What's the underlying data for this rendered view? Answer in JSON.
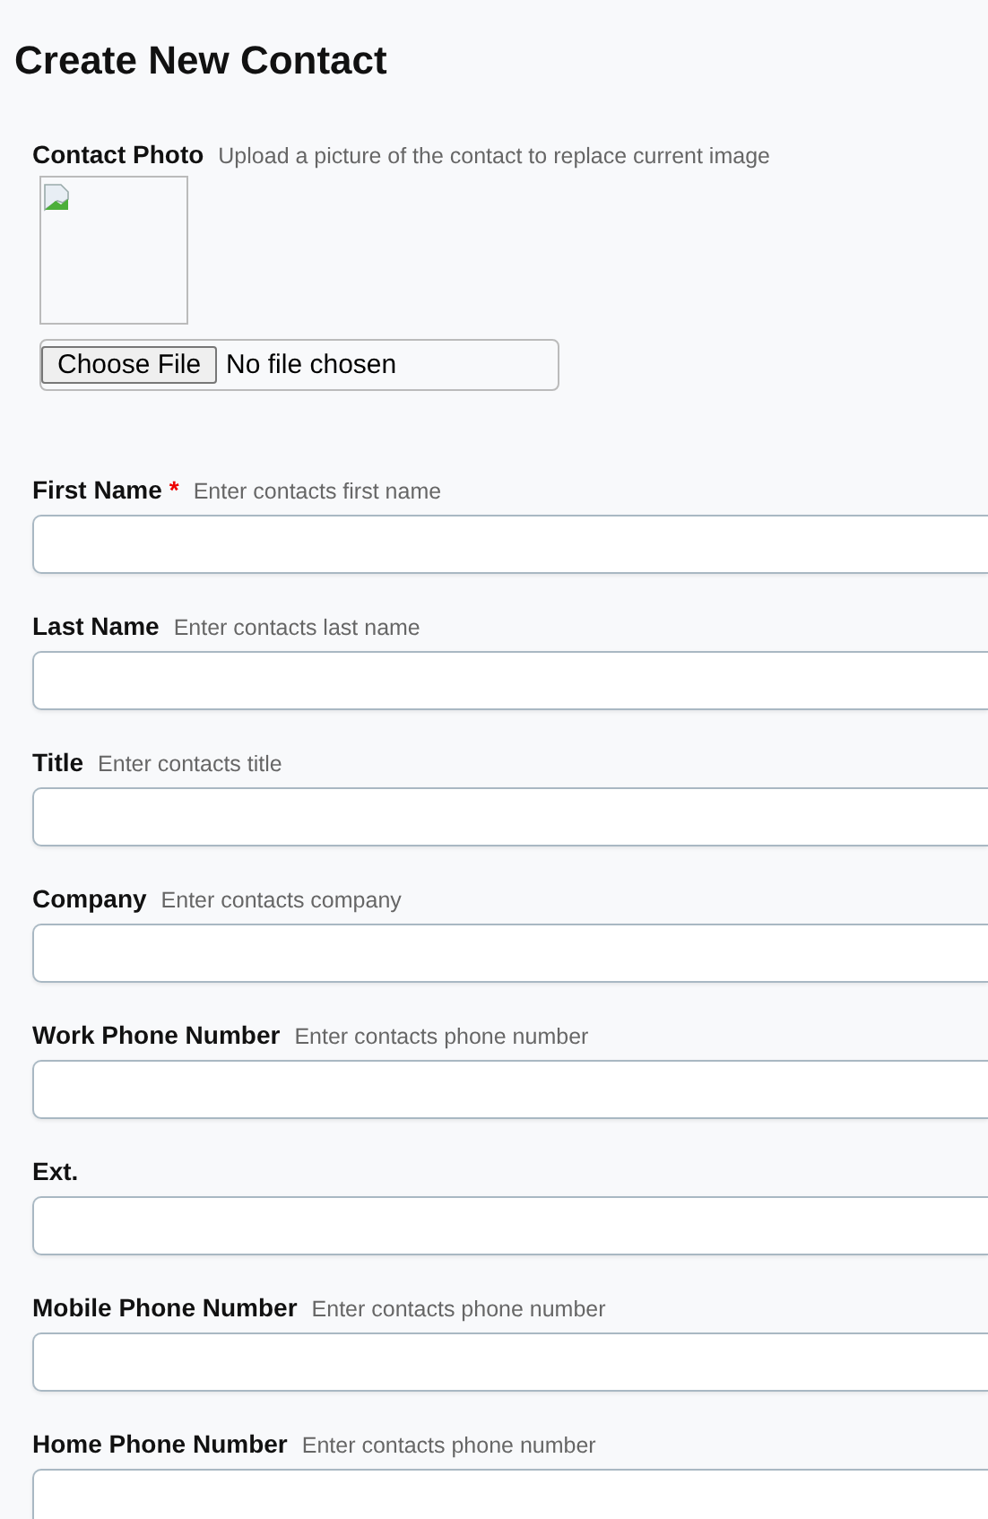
{
  "title": "Create New Contact",
  "photo": {
    "label": "Contact Photo",
    "hint": "Upload a picture of the contact to replace current image",
    "button": "Choose File",
    "status": "No file chosen"
  },
  "fields": [
    {
      "label": "First Name",
      "required": true,
      "hint": "Enter contacts first name"
    },
    {
      "label": "Last Name",
      "required": false,
      "hint": "Enter contacts last name"
    },
    {
      "label": "Title",
      "required": false,
      "hint": "Enter contacts title"
    },
    {
      "label": "Company",
      "required": false,
      "hint": "Enter contacts company"
    },
    {
      "label": "Work Phone Number",
      "required": false,
      "hint": "Enter contacts phone number"
    },
    {
      "label": "Ext.",
      "required": false
    },
    {
      "label": "Mobile Phone Number",
      "required": false,
      "hint": "Enter contacts phone number"
    },
    {
      "label": "Home Phone Number",
      "required": false,
      "hint": "Enter contacts phone number"
    }
  ],
  "required_mark": "*"
}
